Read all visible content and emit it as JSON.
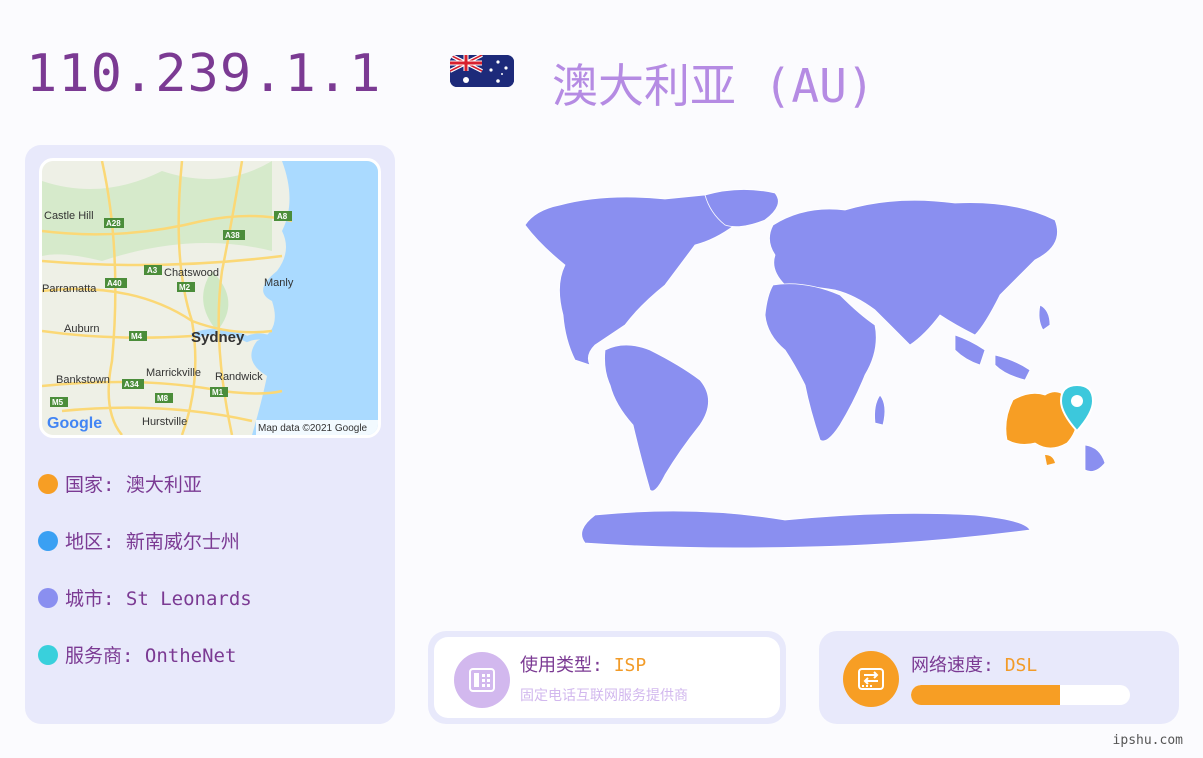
{
  "header": {
    "ip": "110.239.1.1",
    "country_title": "澳大利亚 (AU)",
    "flag_icon": "australia-flag-icon"
  },
  "mini_map": {
    "labels": [
      "Castle Hill",
      "Chatswood",
      "Parramatta",
      "Manly",
      "Auburn",
      "Sydney",
      "Bankstown",
      "Marrickville",
      "Randwick",
      "Hurstville"
    ],
    "road_shields": [
      "A28",
      "A8",
      "A38",
      "A3",
      "M2",
      "A40",
      "M4",
      "A34",
      "M5",
      "M8",
      "M1"
    ],
    "logo": "Google",
    "copyright": "Map data ©2021 Google"
  },
  "info": {
    "country": "国家: 澳大利亚",
    "region": "地区: 新南威尔士州",
    "city": "城市: St Leonards",
    "isp": "服务商: OntheNet",
    "colors": {
      "country": "#f79e24",
      "region": "#3aa0f3",
      "city": "#8a8ff0",
      "isp": "#39d0dc"
    }
  },
  "usage": {
    "label": "使用类型: ",
    "value": "ISP",
    "desc": "固定电话互联网服务提供商",
    "icon": "phone-fax-icon"
  },
  "speed": {
    "label": "网络速度: ",
    "value": "DSL",
    "level_percent": 68,
    "icon": "network-switch-icon"
  },
  "footer": {
    "site": "ipshu.com"
  }
}
